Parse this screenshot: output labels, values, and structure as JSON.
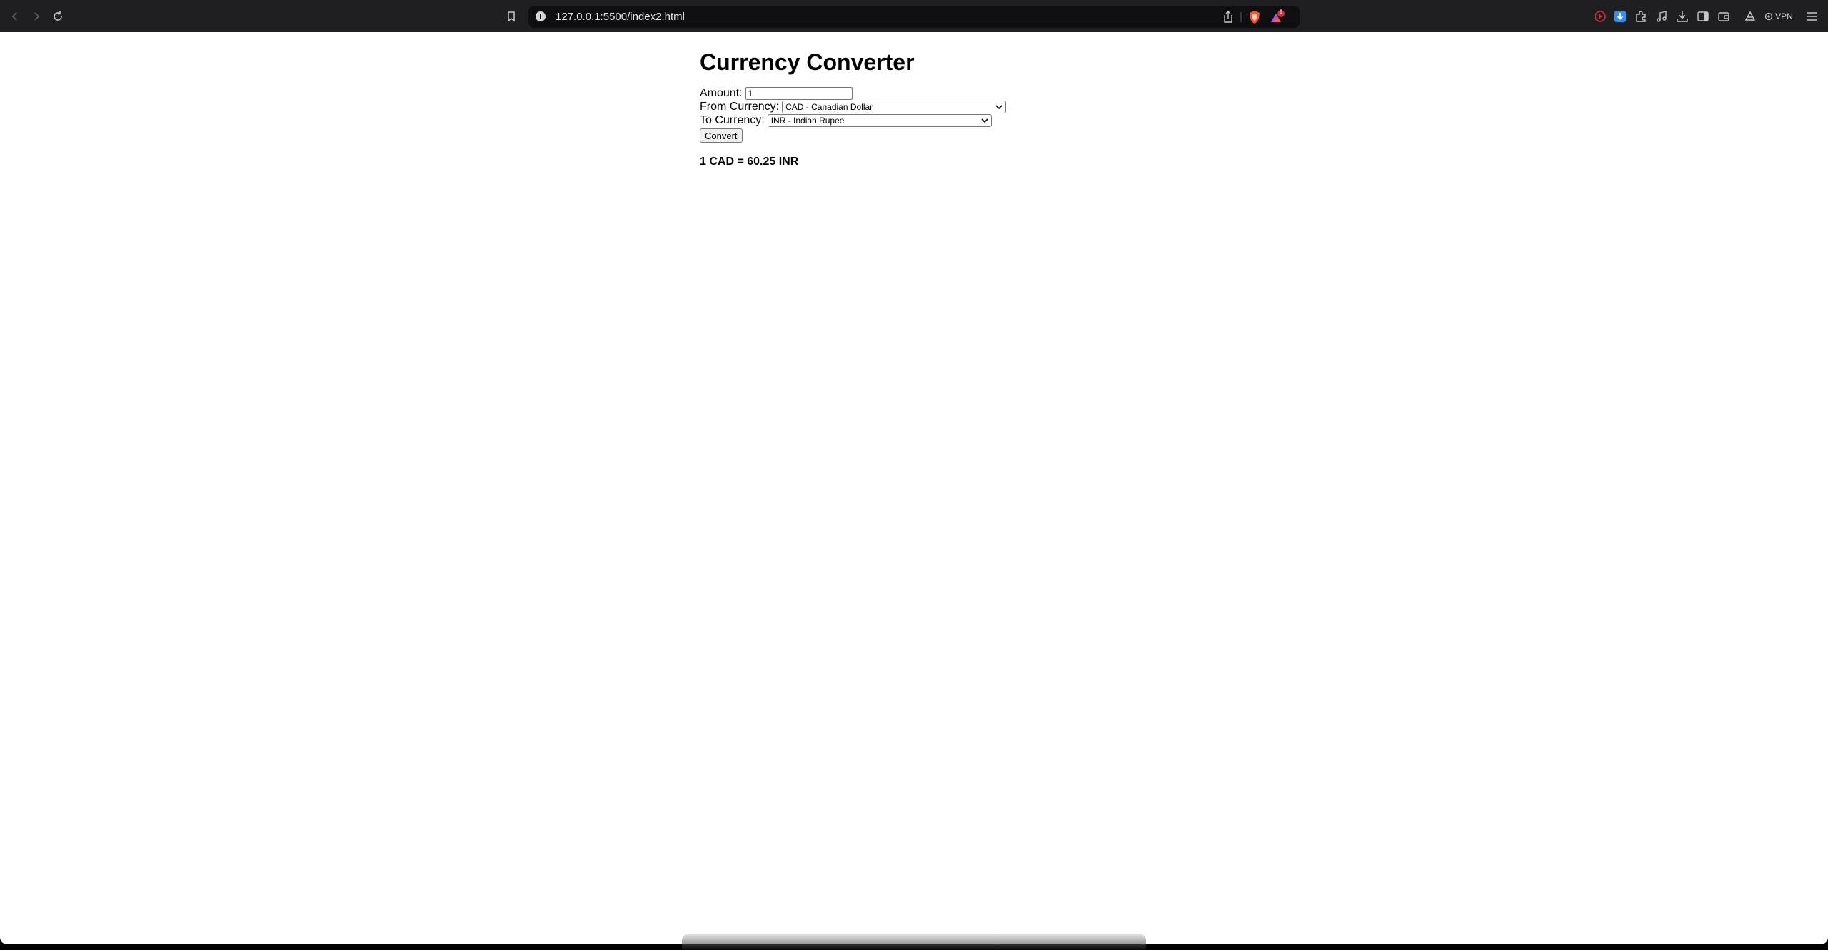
{
  "browser": {
    "url": "127.0.0.1:5500/index2.html",
    "notification_count": "1",
    "vpn_label": "VPN"
  },
  "page": {
    "title": "Currency Converter",
    "amount_label": "Amount:",
    "amount_value": "1",
    "from_label": "From Currency:",
    "from_selected": "CAD - Canadian Dollar",
    "to_label": "To Currency:",
    "to_selected": "INR - Indian Rupee",
    "convert_label": "Convert",
    "result": "1 CAD = 60.25 INR"
  },
  "icons": {
    "back": "chevron-left-icon",
    "forward": "chevron-right-icon",
    "reload": "reload-icon",
    "bookmark": "bookmark-icon"
  },
  "colors": {
    "toolbar": "#1f1f22",
    "urlbar": "#0f0f11",
    "brave_orange": "#fb542b",
    "download_blue": "#3a8df0"
  }
}
